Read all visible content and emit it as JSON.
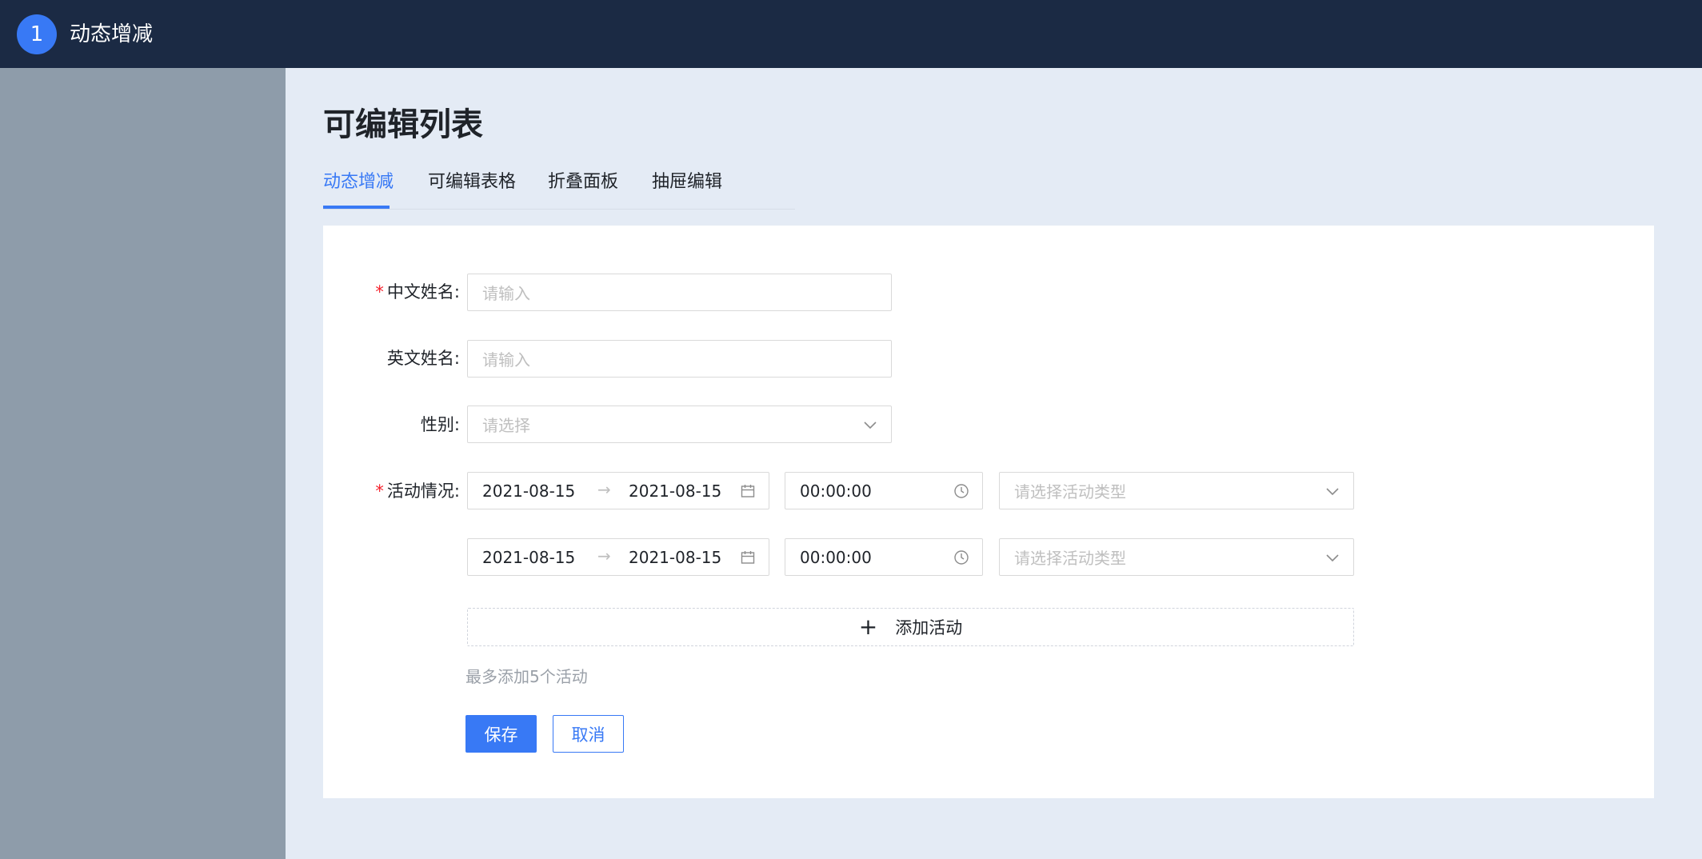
{
  "topbar": {
    "step_number": "1",
    "title": "动态增减"
  },
  "page": {
    "title": "可编辑列表"
  },
  "tabs": [
    {
      "label": "动态增减",
      "active": true
    },
    {
      "label": "可编辑表格",
      "active": false
    },
    {
      "label": "折叠面板",
      "active": false
    },
    {
      "label": "抽屉编辑",
      "active": false
    }
  ],
  "form": {
    "required_mark": "*",
    "cn_name": {
      "label": "中文姓名:",
      "placeholder": "请输入",
      "value": ""
    },
    "en_name": {
      "label": "英文姓名:",
      "placeholder": "请输入",
      "value": ""
    },
    "gender": {
      "label": "性别:",
      "placeholder": "请选择",
      "value": ""
    },
    "activities": {
      "label": "活动情况:",
      "rows": [
        {
          "start_date": "2021-08-15",
          "end_date": "2021-08-15",
          "time": "00:00:00",
          "type_placeholder": "请选择活动类型"
        },
        {
          "start_date": "2021-08-15",
          "end_date": "2021-08-15",
          "time": "00:00:00",
          "type_placeholder": "请选择活动类型"
        }
      ],
      "add_label": "添加活动",
      "hint": "最多添加5个活动"
    },
    "save_label": "保存",
    "cancel_label": "取消"
  },
  "colors": {
    "topbar_bg": "#1b2a44",
    "accent": "#3879f5",
    "sidebar_bg": "#8e9caa",
    "page_bg": "#e4ebf5",
    "required": "#f5222d"
  }
}
